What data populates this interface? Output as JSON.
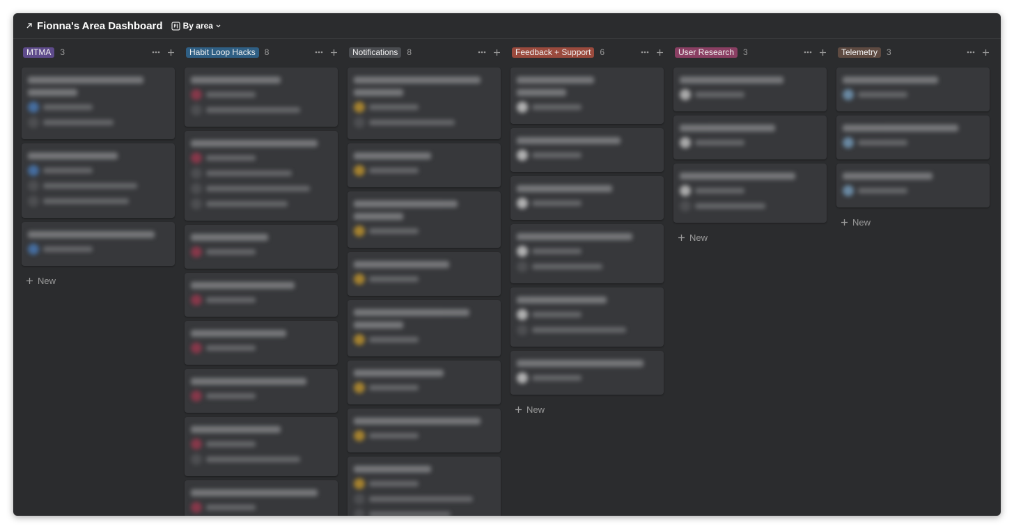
{
  "header": {
    "title": "Fionna's Area Dashboard",
    "view_label": "By area",
    "icons": {
      "back": "arrow-up-right-icon",
      "board": "board-view-icon",
      "chevron": "chevron-down-icon"
    }
  },
  "colors": {
    "background": "#2b2c2e",
    "card": "#37383b",
    "muted_text": "#9a9a9a"
  },
  "new_label": "New",
  "columns": [
    {
      "tag": "MTMA",
      "tag_color": "#5e4b8b",
      "count": "3",
      "accent": "#4a7fc0",
      "cards": [
        {
          "lines": 2,
          "meta": 2
        },
        {
          "lines": 1,
          "meta": 3
        },
        {
          "lines": 1,
          "meta": 1
        }
      ]
    },
    {
      "tag": "Habit Loop Hacks",
      "tag_color": "#2f5f84",
      "count": "8",
      "accent": "#a1384f",
      "cards": [
        {
          "lines": 1,
          "meta": 2
        },
        {
          "lines": 1,
          "meta": 4
        },
        {
          "lines": 1,
          "meta": 1
        },
        {
          "lines": 1,
          "meta": 1
        },
        {
          "lines": 1,
          "meta": 1
        },
        {
          "lines": 1,
          "meta": 1
        },
        {
          "lines": 1,
          "meta": 2
        },
        {
          "lines": 1,
          "meta": 1
        }
      ]
    },
    {
      "tag": "Notifications",
      "tag_color": "#4a4c50",
      "count": "8",
      "accent": "#c99a2b",
      "cards": [
        {
          "lines": 2,
          "meta": 2
        },
        {
          "lines": 1,
          "meta": 1
        },
        {
          "lines": 2,
          "meta": 1
        },
        {
          "lines": 1,
          "meta": 1
        },
        {
          "lines": 2,
          "meta": 1
        },
        {
          "lines": 1,
          "meta": 1
        },
        {
          "lines": 1,
          "meta": 1
        },
        {
          "lines": 1,
          "meta": 3
        }
      ]
    },
    {
      "tag": "Feedback + Support",
      "tag_color": "#9a4a3d",
      "count": "6",
      "accent": "#d8d8d8",
      "cards": [
        {
          "lines": 2,
          "meta": 1
        },
        {
          "lines": 1,
          "meta": 1
        },
        {
          "lines": 1,
          "meta": 1
        },
        {
          "lines": 1,
          "meta": 2
        },
        {
          "lines": 1,
          "meta": 2
        },
        {
          "lines": 1,
          "meta": 1
        }
      ]
    },
    {
      "tag": "User Research",
      "tag_color": "#8a3f63",
      "count": "3",
      "accent": "#cfcfcf",
      "cards": [
        {
          "lines": 1,
          "meta": 1
        },
        {
          "lines": 1,
          "meta": 1
        },
        {
          "lines": 1,
          "meta": 2
        }
      ]
    },
    {
      "tag": "Telemetry",
      "tag_color": "#5e4a41",
      "count": "3",
      "accent": "#7aa3c4",
      "cards": [
        {
          "lines": 1,
          "meta": 1
        },
        {
          "lines": 1,
          "meta": 1
        },
        {
          "lines": 1,
          "meta": 1
        }
      ]
    }
  ]
}
